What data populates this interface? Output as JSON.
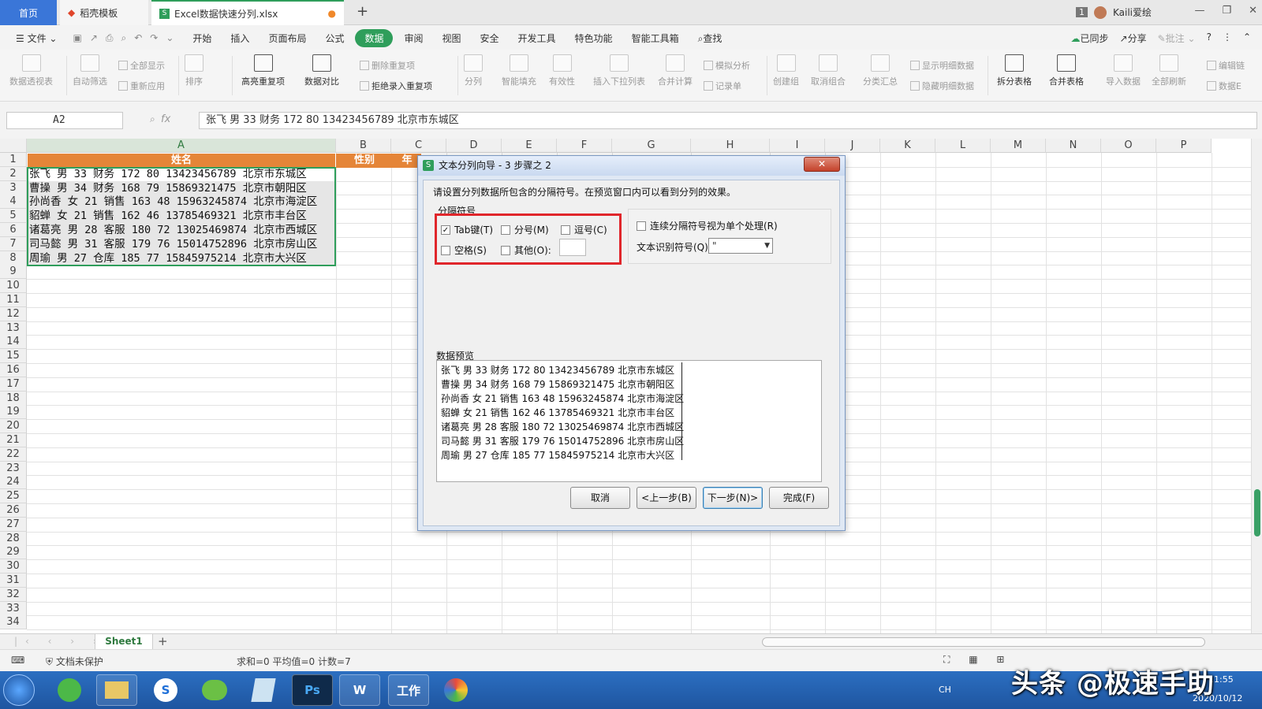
{
  "tabs": {
    "home": "首页",
    "templates": "稻壳模板",
    "file": "Excel数据快速分列.xlsx"
  },
  "account": {
    "badge": "1",
    "name": "Kaili爱绘"
  },
  "menu": {
    "file": "文件",
    "items": [
      "开始",
      "插入",
      "页面布局",
      "公式",
      "数据",
      "审阅",
      "视图",
      "安全",
      "开发工具",
      "特色功能",
      "智能工具箱"
    ],
    "search": "查找",
    "synced": "已同步",
    "share": "分享",
    "comment": "批注"
  },
  "ribbon": {
    "pivot": "数据透视表",
    "autofilter": "自动筛选",
    "showall": "全部显示",
    "reapply": "重新应用",
    "sort": "排序",
    "highlight_dup": "高亮重复项",
    "compare": "数据对比",
    "remove_dup": "删除重复项",
    "reject_dup": "拒绝录入重复项",
    "split": "分列",
    "smart_fill": "智能填充",
    "validity": "有效性",
    "dropdown": "插入下拉列表",
    "consolidate": "合并计算",
    "simulate": "模拟分析",
    "record": "记录单",
    "group": "创建组",
    "ungroup": "取消组合",
    "subtotal": "分类汇总",
    "show_detail": "显示明细数据",
    "hide_detail": "隐藏明细数据",
    "split_table": "拆分表格",
    "merge_table": "合并表格",
    "import": "导入数据",
    "refresh": "全部刷新",
    "edit_link": "编辑链",
    "data_more": "数据E"
  },
  "formula": {
    "cell": "A2",
    "content": "张飞 男 33 财务 172 80 13423456789 北京市东城区"
  },
  "columns": [
    "A",
    "B",
    "C",
    "D",
    "E",
    "F",
    "G",
    "H",
    "I",
    "J",
    "K",
    "L",
    "M",
    "N",
    "O",
    "P"
  ],
  "header_row": {
    "a": "姓名",
    "b": "性别",
    "c": "年"
  },
  "rows": [
    "张飞 男 33 财务 172 80 13423456789 北京市东城区",
    "曹操 男 34 财务 168 79 15869321475 北京市朝阳区",
    "孙尚香 女 21 销售 163 48 15963245874 北京市海淀区",
    "貂蝉 女 21 销售 162 46 13785469321 北京市丰台区",
    "诸葛亮 男 28 客服 180 72 13025469874 北京市西城区",
    "司马懿 男 31 客服 179 76 15014752896 北京市房山区",
    "周瑜 男 27 仓库 185 77 15845975214 北京市大兴区"
  ],
  "row_numbers": [
    "1",
    "2",
    "3",
    "4",
    "5",
    "6",
    "7",
    "8",
    "9",
    "10",
    "11",
    "12",
    "13",
    "14",
    "15",
    "16",
    "17",
    "18",
    "19",
    "20",
    "21",
    "22",
    "23",
    "24",
    "25",
    "26",
    "27",
    "28",
    "29",
    "30",
    "31",
    "32",
    "33",
    "34"
  ],
  "dialog": {
    "title": "文本分列向导 - 3 步骤之 2",
    "instruction": "请设置分列数据所包含的分隔符号。在预览窗口内可以看到分列的效果。",
    "group_label": "分隔符号",
    "tab": "Tab键(T)",
    "semicolon": "分号(M)",
    "comma": "逗号(C)",
    "space": "空格(S)",
    "other": "其他(O):",
    "consecutive": "连续分隔符号视为单个处理(R)",
    "qualifier_label": "文本识别符号(Q):",
    "qualifier_value": "\"",
    "preview_label": "数据预览",
    "cancel": "取消",
    "back": "<上一步(B)",
    "next": "下一步(N)>",
    "finish": "完成(F)"
  },
  "sheet": {
    "name": "Sheet1"
  },
  "status": {
    "protect": "文档未保护",
    "summary": "求和=0  平均值=0  计数=7"
  },
  "taskbar": {
    "ps": "Ps",
    "wps": "W",
    "work": "工作",
    "lang": "CH",
    "time": "11:55",
    "date": "2020/10/12"
  },
  "watermark": "头条 @极速手助"
}
